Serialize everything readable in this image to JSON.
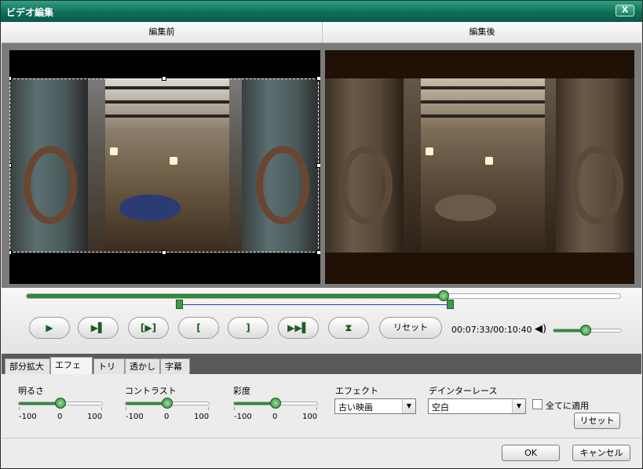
{
  "window": {
    "title": "ビデオ編集",
    "close_label": "X"
  },
  "preview": {
    "before_label": "編集前",
    "after_label": "編集後"
  },
  "playback": {
    "position_fraction": 0.703,
    "trim_start_fraction": 0.257,
    "trim_end_fraction": 0.713,
    "reset_label": "リセット",
    "time_text": "00:07:33/00:10:40",
    "volume_fraction": 0.48,
    "controls": [
      {
        "name": "play",
        "glyph": "▶"
      },
      {
        "name": "next-frame",
        "glyph": "▶▌"
      },
      {
        "name": "snapshot",
        "glyph": "[▶]"
      },
      {
        "name": "set-start",
        "glyph": "["
      },
      {
        "name": "set-end",
        "glyph": "]"
      },
      {
        "name": "go-to-end",
        "glyph": "▶▶▌"
      },
      {
        "name": "split",
        "glyph": "⧗"
      }
    ]
  },
  "tabs": [
    {
      "label": "部分拡大",
      "active": false
    },
    {
      "label": "エフェクト",
      "active": true
    },
    {
      "label": "トリム",
      "active": false
    },
    {
      "label": "透かし",
      "active": false
    },
    {
      "label": "字幕",
      "active": false
    }
  ],
  "effect": {
    "brightness": {
      "label": "明るさ",
      "min": "-100",
      "mid": "0",
      "max": "100",
      "value": 0
    },
    "contrast": {
      "label": "コントラスト",
      "min": "-100",
      "mid": "0",
      "max": "100",
      "value": 0
    },
    "saturation": {
      "label": "彩度",
      "min": "-100",
      "mid": "0",
      "max": "100",
      "value": 0
    },
    "effect_select": {
      "label": "エフェクト",
      "value": "古い映画"
    },
    "deinterlace_select": {
      "label": "デインターレース",
      "value": "空白"
    },
    "apply_all": {
      "label": "全てに適用",
      "checked": false
    },
    "reset_label": "リセット"
  },
  "footer": {
    "ok_label": "OK",
    "cancel_label": "キャンセル"
  },
  "colors": {
    "accent": "#2f8a3a",
    "title_bar": "#0f6e56",
    "cut_line": "#2b3fb8"
  }
}
